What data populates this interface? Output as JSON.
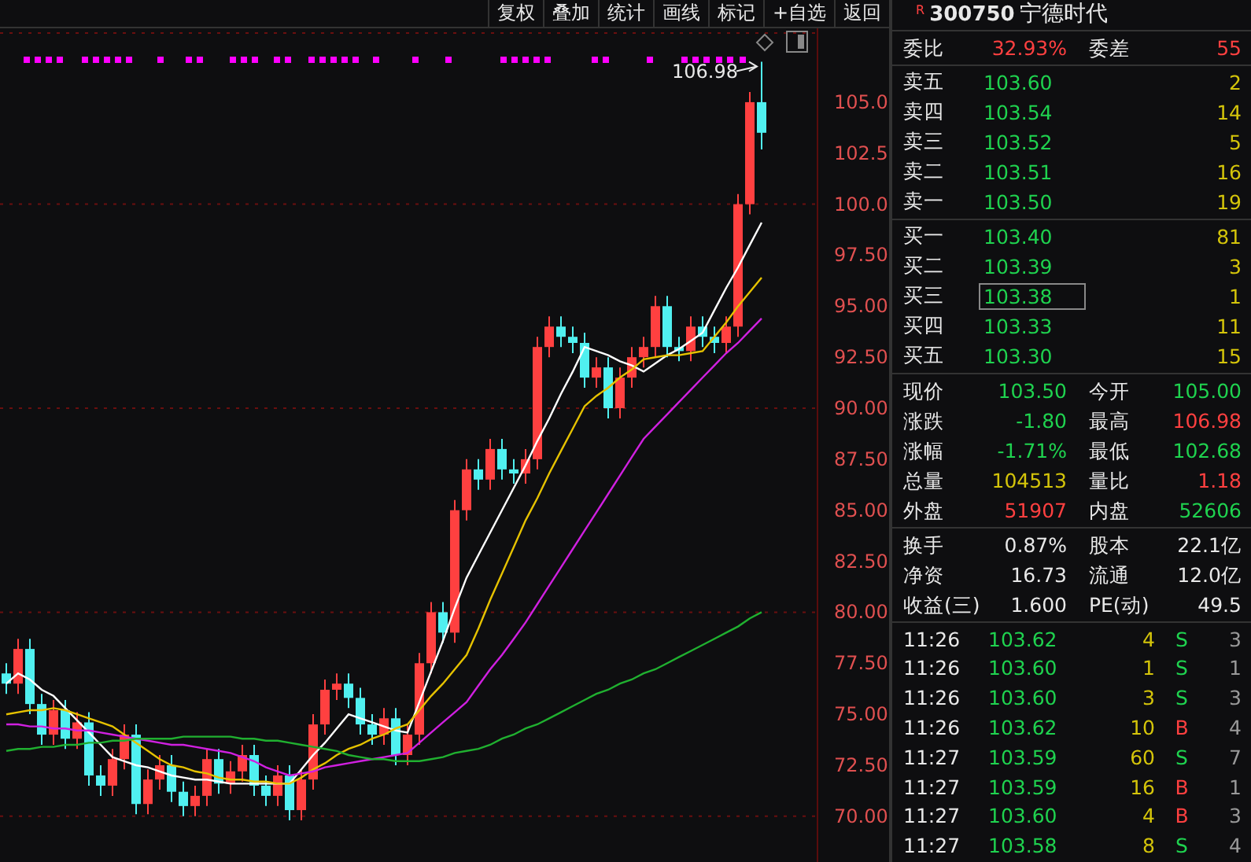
{
  "toolbar": [
    "复权",
    "叠加",
    "统计",
    "画线",
    "标记",
    "+自选",
    "返回"
  ],
  "chart": {
    "high_marker": "106.98",
    "chart_data": {
      "type": "candlestick",
      "ylim": [
        67.68,
        108.62
      ],
      "yticks": [
        {
          "value": 105,
          "label": "105.0"
        },
        {
          "value": 102.5,
          "label": "102.5"
        },
        {
          "value": 100,
          "label": "100.0"
        },
        {
          "value": 97.5,
          "label": "97.50"
        },
        {
          "value": 95,
          "label": "95.00"
        },
        {
          "value": 92.5,
          "label": "92.50"
        },
        {
          "value": 90,
          "label": "90.00"
        },
        {
          "value": 87.5,
          "label": "87.50"
        },
        {
          "value": 85,
          "label": "85.00"
        },
        {
          "value": 82.5,
          "label": "82.50"
        },
        {
          "value": 80,
          "label": "80.00"
        },
        {
          "value": 77.5,
          "label": "77.50"
        },
        {
          "value": 75,
          "label": "75.00"
        },
        {
          "value": 72.5,
          "label": "72.50"
        },
        {
          "value": 70,
          "label": "70.00"
        }
      ],
      "grid": true,
      "ohlc": [
        [
          77,
          77.5,
          76,
          76.5
        ],
        [
          76.5,
          78.7,
          76,
          78.2
        ],
        [
          78.2,
          78.7,
          75,
          75.5
        ],
        [
          75.5,
          76,
          73.5,
          74
        ],
        [
          74,
          75.7,
          73.5,
          75.2
        ],
        [
          75.2,
          75.7,
          73.3,
          73.8
        ],
        [
          73.8,
          75.1,
          73.3,
          74.6
        ],
        [
          74.6,
          75.1,
          71.5,
          72
        ],
        [
          72,
          72.5,
          71,
          71.5
        ],
        [
          71.5,
          73.3,
          71,
          72.8
        ],
        [
          72.8,
          74.5,
          72.3,
          74
        ],
        [
          74,
          74.5,
          70.1,
          70.6
        ],
        [
          70.6,
          72.3,
          70.1,
          71.8
        ],
        [
          71.8,
          73,
          71.3,
          72.5
        ],
        [
          72.5,
          73,
          70.7,
          71.2
        ],
        [
          71.2,
          71.7,
          70,
          70.5
        ],
        [
          70.5,
          71.5,
          70,
          71
        ],
        [
          71,
          73.3,
          70.5,
          72.8
        ],
        [
          72.8,
          73.3,
          71.1,
          71.6
        ],
        [
          71.6,
          72.7,
          71.1,
          72.2
        ],
        [
          72.2,
          73.5,
          71.7,
          73
        ],
        [
          73,
          73.5,
          71,
          71.5
        ],
        [
          71.5,
          72,
          70.5,
          71
        ],
        [
          71,
          72.5,
          70.5,
          72
        ],
        [
          72,
          72.5,
          69.8,
          70.3
        ],
        [
          70.3,
          72.3,
          69.8,
          71.8
        ],
        [
          71.8,
          75,
          71.3,
          74.5
        ],
        [
          74.5,
          76.7,
          74,
          76.2
        ],
        [
          76.2,
          77,
          75.7,
          76.5
        ],
        [
          76.5,
          77,
          75.3,
          75.8
        ],
        [
          75.8,
          76.3,
          74,
          74.5
        ],
        [
          74.5,
          75,
          73.5,
          74
        ],
        [
          74,
          75.3,
          73.5,
          74.8
        ],
        [
          74.8,
          75.3,
          72.5,
          73
        ],
        [
          73,
          74.5,
          72.5,
          74
        ],
        [
          74,
          78,
          73.5,
          77.5
        ],
        [
          77.5,
          80.5,
          77,
          80
        ],
        [
          80,
          80.5,
          78.5,
          79
        ],
        [
          79,
          85.5,
          78.5,
          85
        ],
        [
          85,
          87.5,
          84.5,
          87
        ],
        [
          87,
          87.5,
          86,
          86.5
        ],
        [
          86.5,
          88.5,
          86,
          88
        ],
        [
          88,
          88.5,
          86.5,
          87
        ],
        [
          87,
          87.5,
          86.3,
          86.8
        ],
        [
          86.8,
          88,
          86.3,
          87.5
        ],
        [
          87.5,
          93.5,
          87,
          93
        ],
        [
          93,
          94.5,
          92.5,
          94
        ],
        [
          94,
          94.5,
          93,
          93.5
        ],
        [
          93.5,
          94,
          92.7,
          93.2
        ],
        [
          93.2,
          93.7,
          91,
          91.5
        ],
        [
          91.5,
          92.5,
          91,
          92
        ],
        [
          92,
          92.5,
          89.5,
          90
        ],
        [
          90,
          92,
          89.5,
          91.5
        ],
        [
          91.5,
          93,
          91,
          92.5
        ],
        [
          92.5,
          93.5,
          92,
          93
        ],
        [
          93,
          95.5,
          92.5,
          95
        ],
        [
          95,
          95.5,
          92.5,
          93
        ],
        [
          93,
          93.5,
          92.3,
          92.8
        ],
        [
          92.8,
          94.5,
          92.3,
          94
        ],
        [
          94,
          94.5,
          93,
          93.5
        ],
        [
          93.5,
          94,
          92.7,
          93.2
        ],
        [
          93.2,
          94.5,
          92.7,
          94
        ],
        [
          94,
          100.5,
          93.5,
          100
        ],
        [
          100,
          105.5,
          99.5,
          105
        ],
        [
          105,
          106.98,
          102.68,
          103.5
        ]
      ],
      "series": [
        {
          "type": "line",
          "color": "#ffffff",
          "values": [
            76.5,
            77.0,
            76.7,
            76.2,
            75.9,
            75.3,
            74.7,
            74.1,
            73.5,
            72.9,
            72.7,
            72.5,
            72.4,
            72.2,
            72.0,
            71.9,
            71.8,
            71.8,
            71.7,
            71.6,
            71.6,
            71.6,
            71.6,
            71.6,
            71.6,
            72.3,
            73.0,
            73.6,
            74.3,
            75.0,
            74.8,
            74.6,
            74.4,
            74.2,
            74.1,
            75.6,
            77.1,
            78.6,
            80.2,
            81.7,
            82.8,
            83.9,
            85.0,
            86.1,
            87.2,
            88.4,
            89.5,
            90.7,
            91.8,
            93.0,
            92.8,
            92.6,
            92.3,
            92.1,
            91.8,
            92.2,
            92.6,
            92.9,
            93.3,
            93.7,
            94.8,
            95.9,
            96.9,
            98.0,
            99.1
          ]
        },
        {
          "type": "line",
          "color": "#e6c200",
          "values": [
            75.0,
            75.1,
            75.2,
            75.2,
            75.3,
            75.2,
            75.0,
            74.8,
            74.6,
            74.4,
            74.0,
            73.6,
            73.2,
            72.8,
            72.5,
            72.4,
            72.2,
            72.1,
            71.9,
            71.8,
            71.8,
            71.7,
            71.7,
            71.6,
            71.6,
            71.9,
            72.3,
            72.6,
            73.0,
            73.3,
            73.5,
            73.8,
            74.0,
            74.3,
            74.5,
            75.2,
            75.9,
            76.5,
            77.2,
            77.9,
            79.2,
            80.6,
            81.9,
            83.2,
            84.5,
            85.6,
            86.8,
            87.9,
            89.0,
            90.1,
            90.6,
            91.0,
            91.5,
            91.9,
            92.4,
            92.5,
            92.6,
            92.6,
            92.7,
            92.8,
            93.5,
            94.2,
            95.0,
            95.7,
            96.4
          ]
        },
        {
          "type": "line",
          "color": "#d020e0",
          "values": [
            74.5,
            74.5,
            74.4,
            74.4,
            74.3,
            74.3,
            74.2,
            74.2,
            74.1,
            74.0,
            73.9,
            73.8,
            73.7,
            73.6,
            73.5,
            73.5,
            73.4,
            73.3,
            73.2,
            73.1,
            72.9,
            72.7,
            72.4,
            72.2,
            72.0,
            72.1,
            72.2,
            72.4,
            72.5,
            72.6,
            72.7,
            72.8,
            72.9,
            73.0,
            73.1,
            73.6,
            74.1,
            74.6,
            75.1,
            75.6,
            76.4,
            77.2,
            77.9,
            78.7,
            79.5,
            80.4,
            81.3,
            82.2,
            83.1,
            84.0,
            84.9,
            85.8,
            86.7,
            87.6,
            88.5,
            89.1,
            89.7,
            90.3,
            90.9,
            91.5,
            92.1,
            92.7,
            93.2,
            93.8,
            94.4
          ]
        },
        {
          "type": "line",
          "color": "#20b030",
          "values": [
            73.2,
            73.3,
            73.3,
            73.4,
            73.4,
            73.5,
            73.5,
            73.6,
            73.6,
            73.7,
            73.7,
            73.8,
            73.8,
            73.8,
            73.8,
            73.9,
            73.9,
            73.9,
            73.9,
            73.9,
            73.8,
            73.8,
            73.7,
            73.7,
            73.6,
            73.5,
            73.4,
            73.3,
            73.2,
            73.0,
            72.9,
            72.8,
            72.8,
            72.7,
            72.7,
            72.7,
            72.8,
            72.9,
            73.1,
            73.2,
            73.3,
            73.5,
            73.8,
            74.0,
            74.3,
            74.5,
            74.8,
            75.1,
            75.4,
            75.7,
            76.0,
            76.2,
            76.5,
            76.7,
            77.0,
            77.2,
            77.5,
            77.8,
            78.1,
            78.4,
            78.7,
            79.0,
            79.3,
            79.7,
            80.0
          ]
        }
      ]
    }
  },
  "quote": {
    "badge": "R",
    "code": "300750",
    "name": "宁德时代"
  },
  "ratio": [
    {
      "label": "委比",
      "value": "32.93%",
      "color": "#ff4040"
    },
    {
      "label": "委差",
      "value": "55",
      "color": "#ff4040"
    }
  ],
  "order_book": {
    "sell": [
      {
        "label": "卖五",
        "price": "103.60",
        "volume": "2"
      },
      {
        "label": "卖四",
        "price": "103.54",
        "volume": "14"
      },
      {
        "label": "卖三",
        "price": "103.52",
        "volume": "5"
      },
      {
        "label": "卖二",
        "price": "103.51",
        "volume": "16"
      },
      {
        "label": "卖一",
        "price": "103.50",
        "volume": "19"
      }
    ],
    "buy": [
      {
        "label": "买一",
        "price": "103.40",
        "volume": "81",
        "selected": false
      },
      {
        "label": "买二",
        "price": "103.39",
        "volume": "3",
        "selected": false
      },
      {
        "label": "买三",
        "price": "103.38",
        "volume": "1",
        "selected": true
      },
      {
        "label": "买四",
        "price": "103.33",
        "volume": "11",
        "selected": false
      },
      {
        "label": "买五",
        "price": "103.30",
        "volume": "15",
        "selected": false
      }
    ]
  },
  "stats": [
    {
      "label": "现价",
      "value": "103.50",
      "color": "#1fd24f"
    },
    {
      "label": "今开",
      "value": "105.00",
      "color": "#1fd24f"
    },
    {
      "label": "涨跌",
      "value": "-1.80",
      "color": "#1fd24f"
    },
    {
      "label": "最高",
      "value": "106.98",
      "color": "#ff4040"
    },
    {
      "label": "涨幅",
      "value": "-1.71%",
      "color": "#1fd24f"
    },
    {
      "label": "最低",
      "value": "102.68",
      "color": "#1fd24f"
    },
    {
      "label": "总量",
      "value": "104513",
      "color": "#d4c40a"
    },
    {
      "label": "量比",
      "value": "1.18",
      "color": "#ff4040"
    },
    {
      "label": "外盘",
      "value": "51907",
      "color": "#ff4040"
    },
    {
      "label": "内盘",
      "value": "52606",
      "color": "#1fd24f"
    }
  ],
  "fundamentals": [
    {
      "label": "换手",
      "value": "0.87%"
    },
    {
      "label": "股本",
      "value": "22.1亿"
    },
    {
      "label": "净资",
      "value": "16.73"
    },
    {
      "label": "流通",
      "value": "12.0亿"
    },
    {
      "label": "收益(三)",
      "value": "1.600"
    },
    {
      "label": "PE(动)",
      "value": "49.5"
    }
  ],
  "trades": [
    {
      "time": "11:26",
      "price": "103.62",
      "volume": "4",
      "side": "S",
      "color": "#1fd24f",
      "count": "3"
    },
    {
      "time": "11:26",
      "price": "103.60",
      "volume": "1",
      "side": "S",
      "color": "#1fd24f",
      "count": "1"
    },
    {
      "time": "11:26",
      "price": "103.60",
      "volume": "3",
      "side": "S",
      "color": "#1fd24f",
      "count": "3"
    },
    {
      "time": "11:26",
      "price": "103.62",
      "volume": "10",
      "side": "B",
      "color": "#ff4040",
      "count": "4"
    },
    {
      "time": "11:27",
      "price": "103.59",
      "volume": "60",
      "side": "S",
      "color": "#1fd24f",
      "count": "7"
    },
    {
      "time": "11:27",
      "price": "103.59",
      "volume": "16",
      "side": "B",
      "color": "#ff4040",
      "count": "1"
    },
    {
      "time": "11:27",
      "price": "103.60",
      "volume": "4",
      "side": "B",
      "color": "#ff4040",
      "count": "3"
    },
    {
      "time": "11:27",
      "price": "103.58",
      "volume": "8",
      "side": "S",
      "color": "#1fd24f",
      "count": "4"
    }
  ]
}
